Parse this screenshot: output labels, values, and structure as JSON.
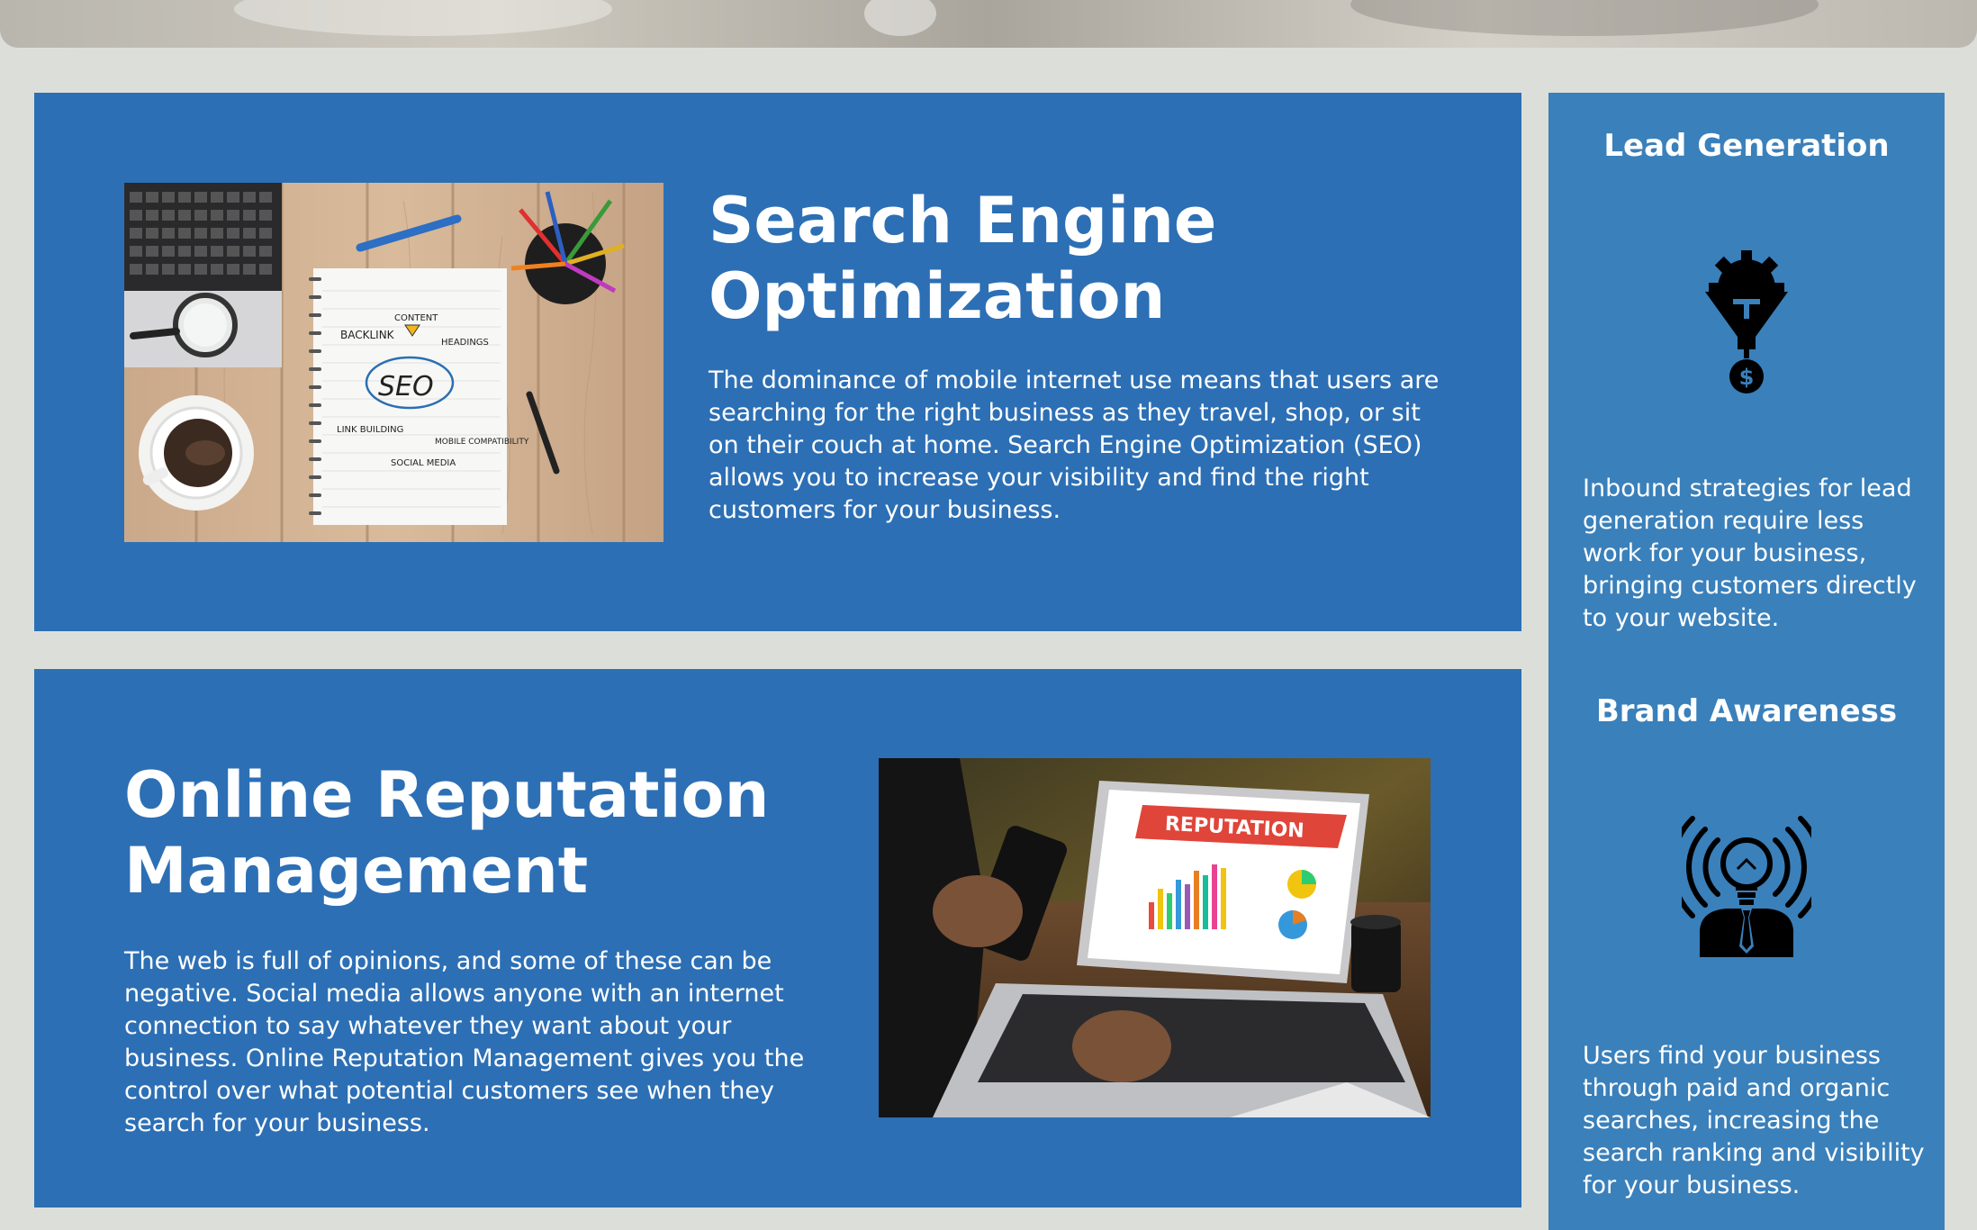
{
  "colors": {
    "page_background": "#dcdfd9",
    "panel_blue": "#2c6fb5",
    "sidebar_blue": "#3a80bb",
    "text": "#ffffff"
  },
  "seo": {
    "title": "Search Engine Optimization",
    "text": "The dominance of mobile internet use means that users are searching for the right business as they travel, shop, or sit on their couch at home. Search Engine Optimization (SEO) allows you to increase your visibility and find the right customers for your business.",
    "image": {
      "description": "SEO notebook on wooden desk",
      "labels": [
        "CONTENT",
        "BACKLINK",
        "HEADINGS",
        "SEO",
        "LINK BUILDING",
        "MOBILE COMPATIBILITY",
        "SOCIAL MEDIA"
      ]
    }
  },
  "orm": {
    "title": "Online Reputation Management",
    "text": "The web is full of opinions, and some of these can be negative. Social media allows anyone with an internet connection to say whatever they want about your business. Online Reputation Management gives you the control over what potential customers see when they search for your business.",
    "image": {
      "description": "Laptop showing reputation dashboard",
      "banner": "REPUTATION"
    }
  },
  "sidebar": {
    "lead": {
      "title": "Lead Generation",
      "icon": "funnel-gear-dollar-icon",
      "text": "Inbound strategies for lead generation require less work for your business, bringing customers directly to your website."
    },
    "brand": {
      "title": "Brand Awareness",
      "icon": "lightbulb-head-broadcast-icon",
      "text": "Users find your business through paid and organic searches, increasing the search ranking and visibility for your business."
    }
  }
}
